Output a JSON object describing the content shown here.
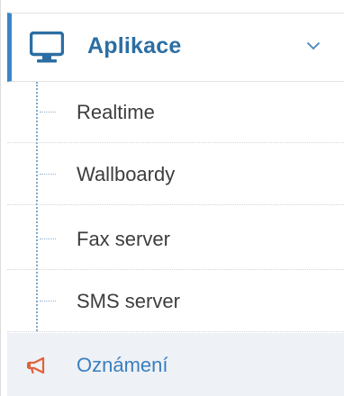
{
  "menu": {
    "header": {
      "title": "Aplikace",
      "icon": "monitor-icon",
      "toggle_icon": "chevron-down-icon"
    },
    "items": [
      {
        "label": "Realtime"
      },
      {
        "label": "Wallboardy"
      },
      {
        "label": "Fax server"
      },
      {
        "label": "SMS server"
      },
      {
        "label": "Oznámení",
        "icon": "megaphone-icon"
      }
    ]
  },
  "colors": {
    "accent": "#3a87c6",
    "title": "#2c6ea3",
    "active_label": "#3a7fbf",
    "megaphone": "#e0623a",
    "text": "#3d3d3d"
  }
}
